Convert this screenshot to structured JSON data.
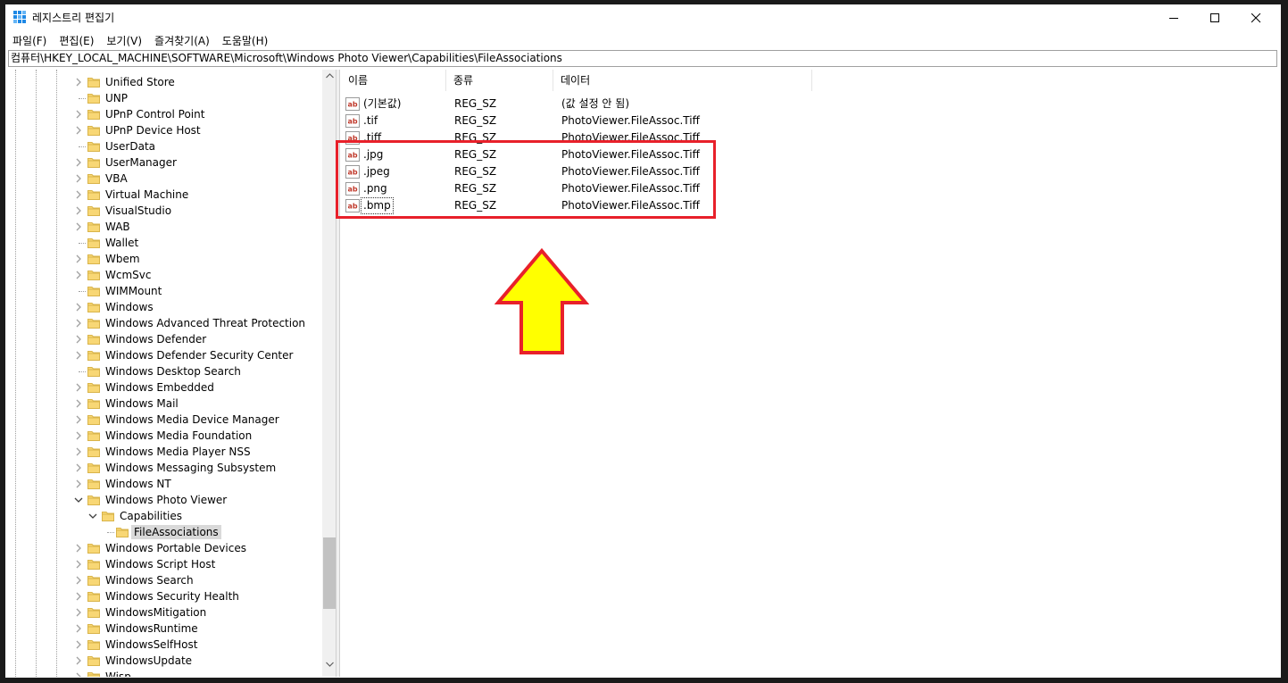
{
  "window": {
    "title": "레지스트리 편집기"
  },
  "menu": [
    "파일(F)",
    "편집(E)",
    "보기(V)",
    "즐겨찾기(A)",
    "도움말(H)"
  ],
  "address": "컴퓨터\\HKEY_LOCAL_MACHINE\\SOFTWARE\\Microsoft\\Windows Photo Viewer\\Capabilities\\FileAssociations",
  "tree": [
    {
      "label": "Unified Store",
      "expandable": true
    },
    {
      "label": "UNP",
      "expandable": false
    },
    {
      "label": "UPnP Control Point",
      "expandable": true
    },
    {
      "label": "UPnP Device Host",
      "expandable": true
    },
    {
      "label": "UserData",
      "expandable": false
    },
    {
      "label": "UserManager",
      "expandable": true
    },
    {
      "label": "VBA",
      "expandable": true
    },
    {
      "label": "Virtual Machine",
      "expandable": true
    },
    {
      "label": "VisualStudio",
      "expandable": true
    },
    {
      "label": "WAB",
      "expandable": true
    },
    {
      "label": "Wallet",
      "expandable": false
    },
    {
      "label": "Wbem",
      "expandable": true
    },
    {
      "label": "WcmSvc",
      "expandable": true
    },
    {
      "label": "WIMMount",
      "expandable": false
    },
    {
      "label": "Windows",
      "expandable": true
    },
    {
      "label": "Windows Advanced Threat Protection",
      "expandable": true
    },
    {
      "label": "Windows Defender",
      "expandable": true
    },
    {
      "label": "Windows Defender Security Center",
      "expandable": true
    },
    {
      "label": "Windows Desktop Search",
      "expandable": false
    },
    {
      "label": "Windows Embedded",
      "expandable": true
    },
    {
      "label": "Windows Mail",
      "expandable": true
    },
    {
      "label": "Windows Media Device Manager",
      "expandable": true
    },
    {
      "label": "Windows Media Foundation",
      "expandable": true
    },
    {
      "label": "Windows Media Player NSS",
      "expandable": true
    },
    {
      "label": "Windows Messaging Subsystem",
      "expandable": true
    },
    {
      "label": "Windows NT",
      "expandable": true
    },
    {
      "label": "Windows Photo Viewer",
      "expandable": true,
      "expanded": true
    },
    {
      "label": "Capabilities",
      "expandable": true,
      "expanded": true,
      "level": 1
    },
    {
      "label": "FileAssociations",
      "expandable": false,
      "level": 2,
      "selected": true
    },
    {
      "label": "Windows Portable Devices",
      "expandable": true
    },
    {
      "label": "Windows Script Host",
      "expandable": true
    },
    {
      "label": "Windows Search",
      "expandable": true
    },
    {
      "label": "Windows Security Health",
      "expandable": true
    },
    {
      "label": "WindowsMitigation",
      "expandable": true
    },
    {
      "label": "WindowsRuntime",
      "expandable": true
    },
    {
      "label": "WindowsSelfHost",
      "expandable": true
    },
    {
      "label": "WindowsUpdate",
      "expandable": true
    },
    {
      "label": "Wisp",
      "expandable": true
    }
  ],
  "columns": {
    "name": "이름",
    "type": "종류",
    "data": "데이터"
  },
  "values": [
    {
      "name": "(기본값)",
      "type": "REG_SZ",
      "data": "(값 설정 안 됨)"
    },
    {
      "name": ".tif",
      "type": "REG_SZ",
      "data": "PhotoViewer.FileAssoc.Tiff"
    },
    {
      "name": ".tiff",
      "type": "REG_SZ",
      "data": "PhotoViewer.FileAssoc.Tiff"
    },
    {
      "name": ".jpg",
      "type": "REG_SZ",
      "data": "PhotoViewer.FileAssoc.Tiff"
    },
    {
      "name": ".jpeg",
      "type": "REG_SZ",
      "data": "PhotoViewer.FileAssoc.Tiff"
    },
    {
      "name": ".png",
      "type": "REG_SZ",
      "data": "PhotoViewer.FileAssoc.Tiff"
    },
    {
      "name": ".bmp",
      "type": "REG_SZ",
      "data": "PhotoViewer.FileAssoc.Tiff",
      "focused": true
    }
  ],
  "colors": {
    "highlight": "#e8202a",
    "arrow_fill": "#ffff00",
    "folder": "#f8d775"
  },
  "icons": {
    "value_type": "ab-string-icon",
    "folder": "folder-icon"
  }
}
